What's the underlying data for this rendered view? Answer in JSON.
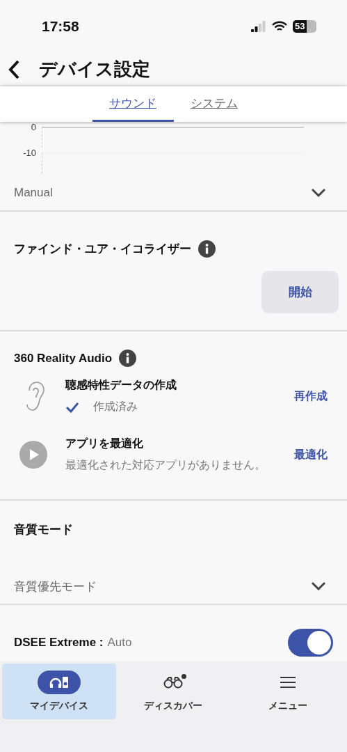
{
  "status_bar": {
    "time": "17:58",
    "battery": "53"
  },
  "header": {
    "title": "デバイス設定"
  },
  "tabs": [
    {
      "label": "サウンド",
      "selected": true
    },
    {
      "label": "システム",
      "selected": false
    }
  ],
  "equalizer": {
    "tick_labels": [
      "0",
      "-10"
    ],
    "preset": "Manual"
  },
  "find_your_equalizer": {
    "title": "ファインド・ユア・イコライザー",
    "button": "開始"
  },
  "reality_audio": {
    "title": "360 Reality Audio",
    "items": [
      {
        "kind": "ear",
        "title": "聴感特性データの作成",
        "status": "作成済み",
        "checked": true,
        "action": "再作成"
      },
      {
        "kind": "play",
        "title": "アプリを最適化",
        "status": "最適化された対応アプリがありません。",
        "checked": false,
        "action": "最適化"
      }
    ]
  },
  "sound_quality_mode": {
    "title": "音質モード",
    "value": "音質優先モード"
  },
  "dsee": {
    "label": "DSEE Extreme :",
    "value": "Auto",
    "on": true
  },
  "bottom_nav": [
    {
      "kind": "device",
      "label": "マイデバイス",
      "selected": true,
      "badge": false
    },
    {
      "kind": "discover",
      "label": "ディスカバー",
      "selected": false,
      "badge": true
    },
    {
      "kind": "menu",
      "label": "メニュー",
      "selected": false,
      "badge": false
    }
  ]
}
